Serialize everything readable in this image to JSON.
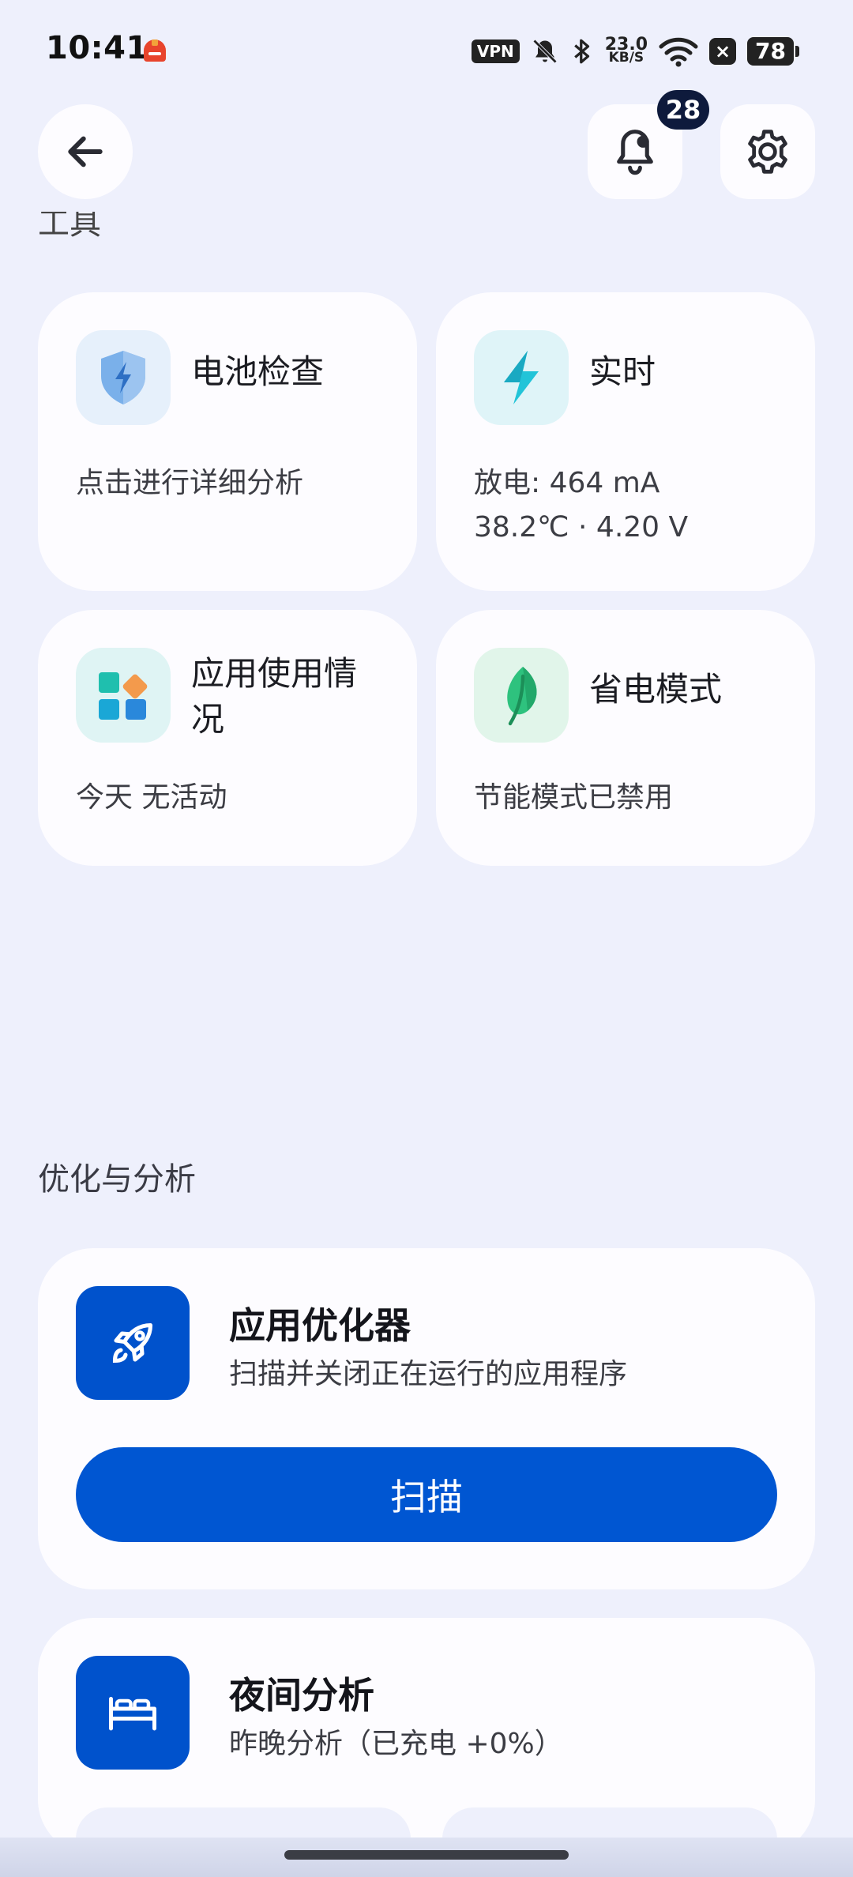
{
  "status_bar": {
    "time": "10:41",
    "vpn": "VPN",
    "net_speed_value": "23.0",
    "net_speed_unit": "KB/S",
    "battery_level": "78"
  },
  "header": {
    "notification_count": "28",
    "faded_section_title": "工具"
  },
  "tools": [
    {
      "title": "电池检查",
      "line1": "点击进行详细分析",
      "line2": ""
    },
    {
      "title": "实时",
      "line1": "放电: 464 mA",
      "line2": "38.2℃ · 4.20 V"
    },
    {
      "title": "应用使用情况",
      "line1": "今天 无活动",
      "line2": ""
    },
    {
      "title": "省电模式",
      "line1": "节能模式已禁用",
      "line2": ""
    }
  ],
  "optimization": {
    "section_title": "优化与分析",
    "app_optimizer": {
      "title": "应用优化器",
      "subtitle": "扫描并关闭正在运行的应用程序",
      "button": "扫描"
    },
    "night_analysis": {
      "title": "夜间分析",
      "subtitle": "昨晚分析（已充电 +0%）"
    }
  },
  "colors": {
    "background": "#eef0fc",
    "card": "#fdfcff",
    "primary": "#0056d2",
    "badge": "#0e1a3c"
  }
}
